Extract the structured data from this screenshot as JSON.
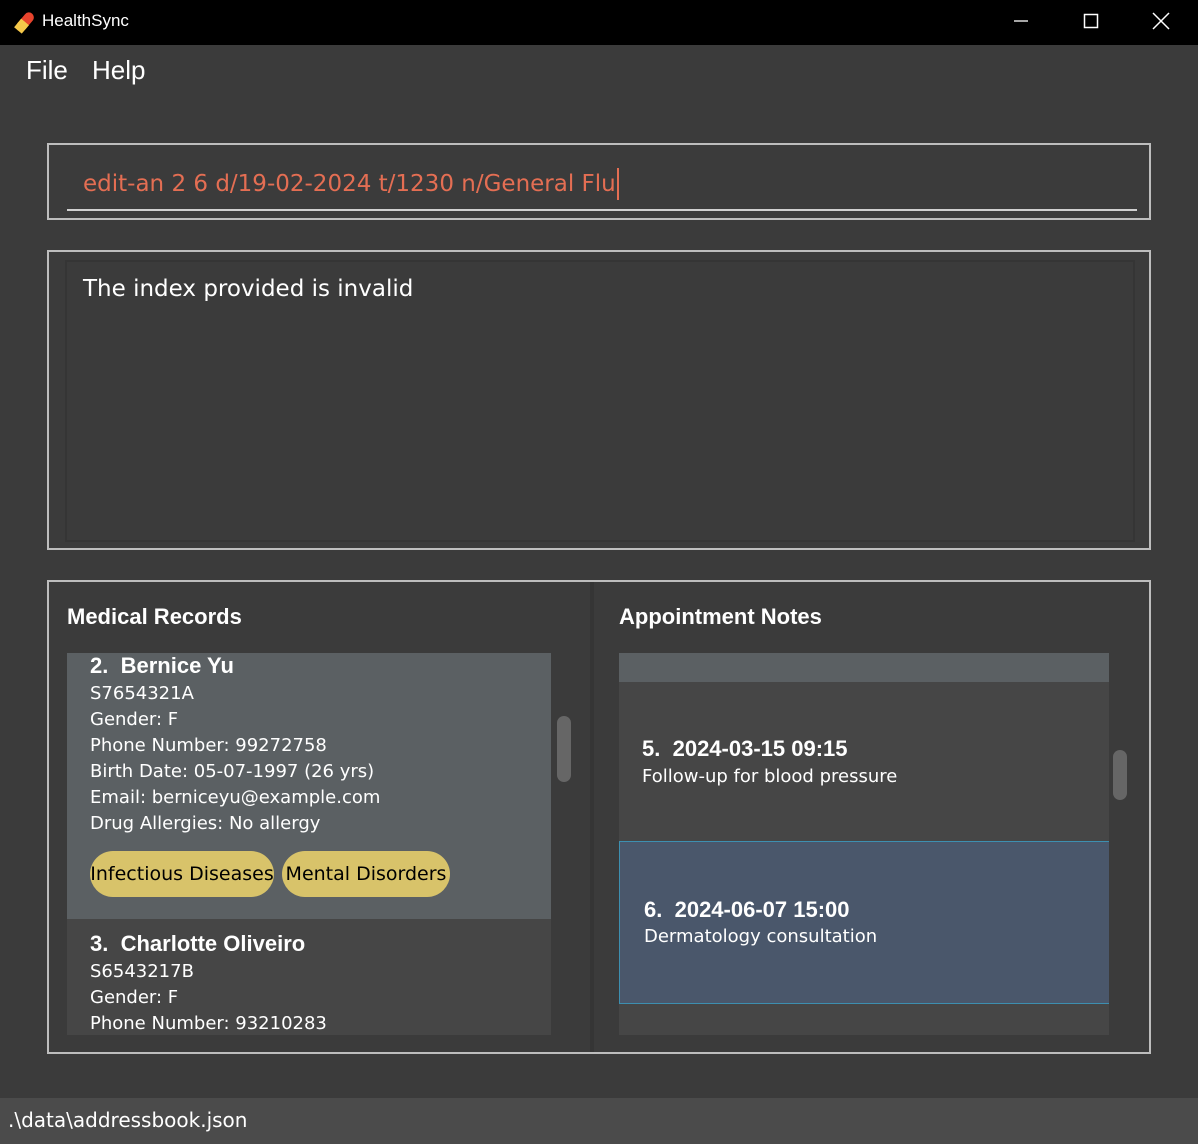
{
  "window": {
    "title": "HealthSync",
    "icon": "pill-icon"
  },
  "menu": {
    "file": "File",
    "help": "Help"
  },
  "command": {
    "value": "edit-an 2 6 d/19-02-2024 t/1230 n/General Flu"
  },
  "result": {
    "message": "The index provided is invalid"
  },
  "records": {
    "title": "Medical Records",
    "items": [
      {
        "index": "2.",
        "name": "Bernice Yu",
        "nric": "S7654321A",
        "gender": "Gender: F",
        "phone": "Phone Number: 99272758",
        "birth": "Birth Date: 05-07-1997 (26 yrs)",
        "email": "Email: berniceyu@example.com",
        "allergies": "Drug Allergies: No allergy",
        "tags": [
          "Infectious Diseases",
          "Mental Disorders"
        ]
      },
      {
        "index": "3.",
        "name": "Charlotte Oliveiro",
        "nric": "S6543217B",
        "gender": "Gender: F",
        "phone": "Phone Number: 93210283"
      }
    ]
  },
  "notes": {
    "title": "Appointment Notes",
    "items": [
      {
        "index": "5.",
        "datetime": "2024-03-15 09:15",
        "description": "Follow-up for blood pressure"
      },
      {
        "index": "6.",
        "datetime": "2024-06-07 15:00",
        "description": "Dermatology consultation"
      }
    ]
  },
  "status": {
    "path": ".\\data\\addressbook.json"
  },
  "colors": {
    "background": "#3b3b3b",
    "command_text": "#e46e53",
    "tag": "#d8c36a",
    "selected_card": "#5b6063",
    "selected_note": "#4a576b",
    "selected_note_border": "#3d8fb0"
  }
}
